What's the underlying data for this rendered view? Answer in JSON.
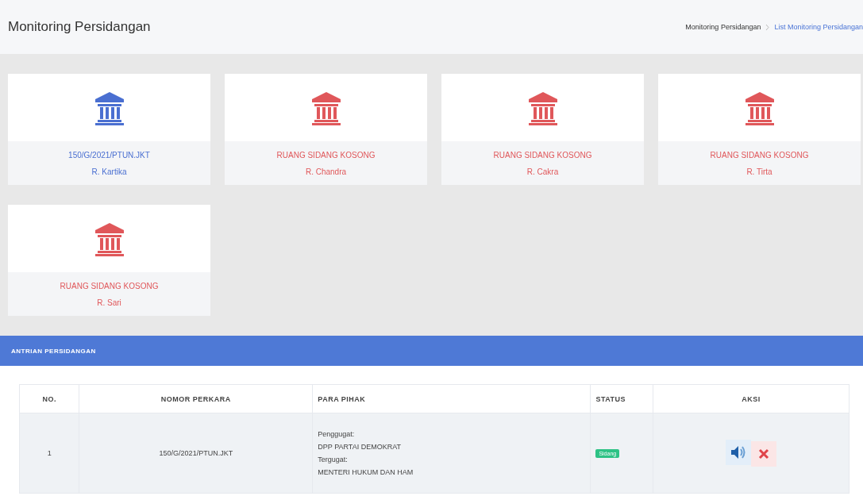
{
  "header": {
    "title": "Monitoring Persidangan",
    "breadcrumb": [
      {
        "label": "Monitoring Persidangan",
        "selected": false
      },
      {
        "label": "List Monitoring Persidangan",
        "selected": true
      }
    ]
  },
  "rooms": [
    {
      "case": "150/G/2021/PTUN.JKT",
      "room": "R. Kartika",
      "kind": "occupied"
    },
    {
      "case": "RUANG SIDANG KOSONG",
      "room": "R. Chandra",
      "kind": "empty"
    },
    {
      "case": "RUANG SIDANG KOSONG",
      "room": "R. Cakra",
      "kind": "empty"
    },
    {
      "case": "RUANG SIDANG KOSONG",
      "room": "R. Tirta",
      "kind": "empty"
    },
    {
      "case": "RUANG SIDANG KOSONG",
      "room": "R. Sari",
      "kind": "empty"
    }
  ],
  "queue": {
    "title": "ANTRIAN PERSIDANGAN",
    "columns": [
      "NO.",
      "NOMOR PERKARA",
      "PARA PIHAK",
      "STATUS",
      "AKSI"
    ],
    "rows": [
      {
        "no": "1",
        "case": "150/G/2021/PTUN.JKT",
        "parties": [
          "Penggugat:",
          "DPP PARTAI DEMOKRAT",
          "Tergugat:",
          "MENTERI HUKUM DAN HAM"
        ],
        "status": "Sidang"
      }
    ]
  }
}
